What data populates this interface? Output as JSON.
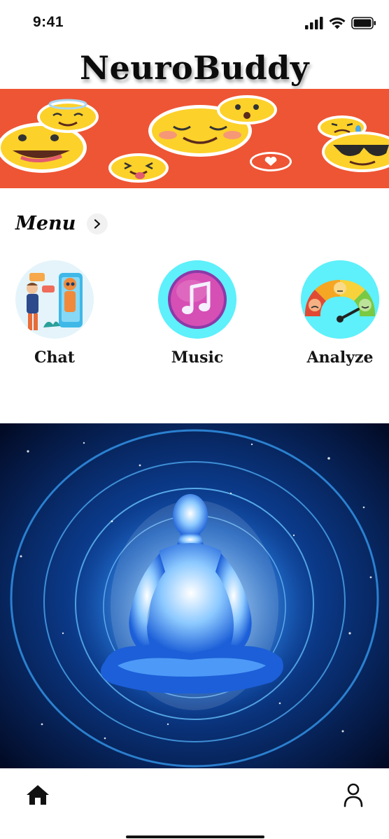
{
  "status_bar": {
    "time": "9:41",
    "icons": [
      "signal-icon",
      "wifi-icon",
      "battery-icon"
    ]
  },
  "app": {
    "title": "NeuroBuddy"
  },
  "banner": {
    "image": "emoji-faces-banner",
    "background_color": "#ee5535"
  },
  "menu": {
    "title": "Menu",
    "arrow_icon": "chevron-right-icon",
    "items": [
      {
        "label": "Chat",
        "icon": "chat-robot-illustration"
      },
      {
        "label": "Music",
        "icon": "music-note-icon"
      },
      {
        "label": "Analyze",
        "icon": "mood-gauge-icon"
      }
    ]
  },
  "hero": {
    "image": "meditation-silhouette-cosmic-aura"
  },
  "tab_bar": {
    "tabs": [
      {
        "name": "home",
        "icon": "home-icon"
      },
      {
        "name": "profile",
        "icon": "profile-icon"
      }
    ]
  },
  "colors": {
    "banner": "#ee5535",
    "icon_circle": "#5ef0fb",
    "music_pink": "#d64fb5",
    "hero_blue": "#1a7fe0"
  }
}
